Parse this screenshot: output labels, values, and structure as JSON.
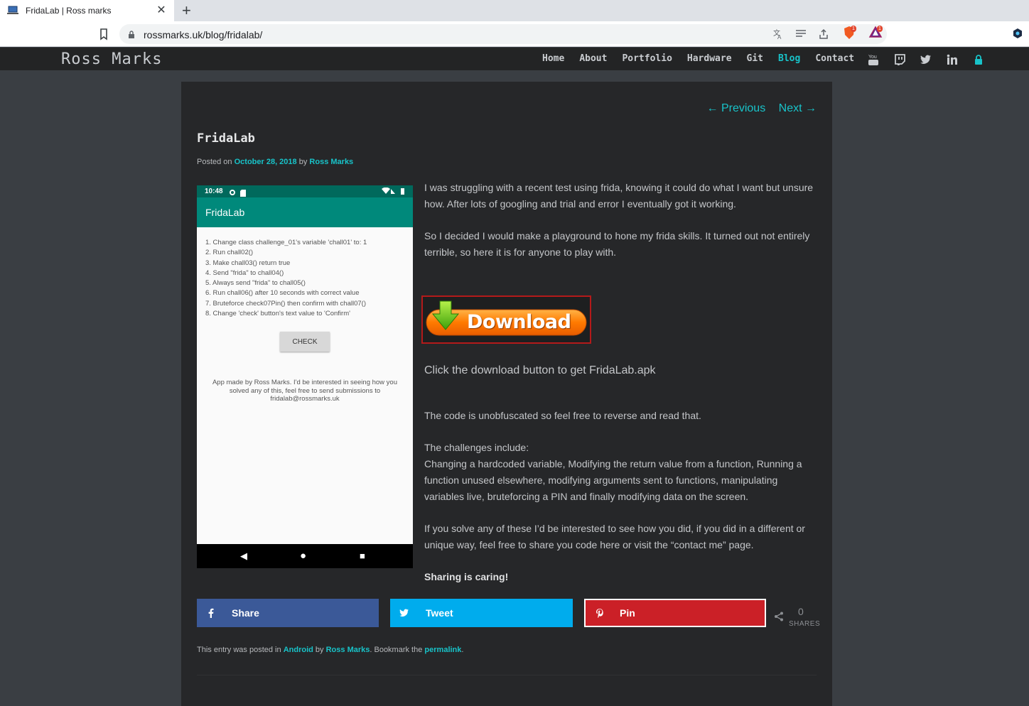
{
  "browser": {
    "tab_title": "FridaLab | Ross marks",
    "tab_close": "✕",
    "new_tab": "+",
    "url": "rossmarks.uk/blog/fridalab/",
    "shield_badge": "1",
    "rewards_badge": "1"
  },
  "site": {
    "title": "Ross Marks",
    "nav": [
      "Home",
      "About",
      "Portfolio",
      "Hardware",
      "Git",
      "Blog",
      "Contact"
    ],
    "active_nav": "Blog",
    "social_icons": [
      "youtube-icon",
      "twitch-icon",
      "twitter-icon",
      "linkedin-icon",
      "lock-icon"
    ],
    "accent": "#18c3c9"
  },
  "post": {
    "prev": "← Previous",
    "next": "Next →",
    "title": "FridaLab",
    "posted_on": "Posted on",
    "date": "October 28, 2018",
    "by": "by",
    "author": "Ross Marks",
    "para1": "I was struggling with a recent test using frida, knowing it could do what I want but unsure how. After lots of googling and trial and error I eventually got it working.",
    "para2": "So I decided I would make a playground to hone my frida skills. It turned out not entirely terrible, so here it is for anyone to play with.",
    "download_label": "Download",
    "click_text": "Click the download button to get FridaLab.apk",
    "para3": "The code is unobfuscated so feel free to reverse and read that.",
    "challenges_heading": "The challenges include:",
    "para4": "Changing a hardcoded variable, Modifying the return value from a function, Running a function unused elsewhere, modifying arguments sent to functions, manipulating variables live, bruteforcing a PIN and finally modifying data on the screen.",
    "para5": "If you solve any of these I’d be interested to see how you did, if you did in a different or unique way, feel free to share you code here or visit the “contact me” page.",
    "sharing": "Sharing is caring!"
  },
  "phone": {
    "time": "10:48",
    "app_title": "FridaLab",
    "challenges": [
      "1. Change class challenge_01's variable 'chall01' to: 1",
      "2. Run chall02()",
      "3. Make chall03() return true",
      "4. Send \"frida\" to chall04()",
      "5. Always send \"frida\" to chall05()",
      "6. Run chall06() after 10 seconds with correct value",
      "7. Bruteforce check07Pin() then confirm with chall07()",
      "8. Change 'check' button's text value to 'Confirm'"
    ],
    "check_label": "CHECK",
    "note": "App made by Ross Marks. I'd be interested in seeing how you solved any of this, feel free to send submissions to fridalab@rossmarks.uk"
  },
  "share": {
    "facebook": "Share",
    "twitter": "Tweet",
    "pinterest": "Pin",
    "count": "0",
    "count_label": "SHARES",
    "colors": {
      "facebook": "#3b5998",
      "twitter": "#00aced",
      "pinterest": "#cb2027"
    }
  },
  "footer": {
    "prefix": "This entry was posted in",
    "category": "Android",
    "by": "by",
    "author": "Ross Marks",
    "bookmark": ". Bookmark the",
    "permalink": "permalink",
    "end": "."
  }
}
